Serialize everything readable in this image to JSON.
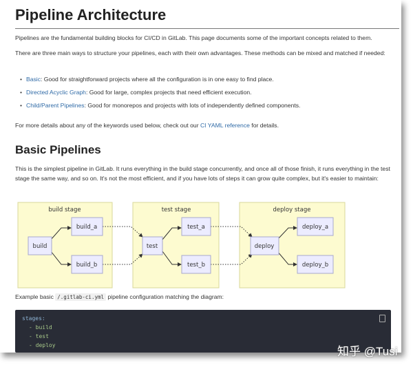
{
  "title": "Pipeline Architecture",
  "intro": "Pipelines are the fundamental building blocks for CI/CD in GitLab. This page documents some of the important concepts related to them.",
  "ways": "There are three main ways to structure your pipelines, each with their own advantages. These methods can be mixed and matched if needed:",
  "bullets": [
    {
      "link": "Basic",
      "text": ": Good for straightforward projects where all the configuration is in one easy to find place."
    },
    {
      "link": "Directed Acyclic Graph",
      "text": ": Good for large, complex projects that need efficient execution."
    },
    {
      "link": "Child/Parent Pipelines",
      "text": ": Good for monorepos and projects with lots of independently defined components."
    }
  ],
  "more": {
    "before": "For more details about any of the keywords used below, check out our ",
    "link": "CI YAML reference",
    "after": " for details."
  },
  "basic": {
    "heading": "Basic Pipelines",
    "text": "This is the simplest pipeline in GitLab. It runs everything in the build stage concurrently, and once all of those finish, it runs everything in the test stage the same way, and so on. It's not the most efficient, and if you have lots of steps it can grow quite complex, but it's easier to maintain:"
  },
  "diagram": {
    "stages": [
      "build stage",
      "test stage",
      "deploy stage"
    ],
    "nodes": [
      "build",
      "build_a",
      "build_b",
      "test",
      "test_a",
      "test_b",
      "deploy",
      "deploy_a",
      "deploy_b"
    ]
  },
  "example": {
    "before": "Example basic ",
    "code": "/.gitlab-ci.yml",
    "after": " pipeline configuration matching the diagram:"
  },
  "code": {
    "key": "stages:",
    "items": [
      "- build",
      "- test",
      "- deploy"
    ]
  },
  "watermark": "知乎 @Tusi"
}
